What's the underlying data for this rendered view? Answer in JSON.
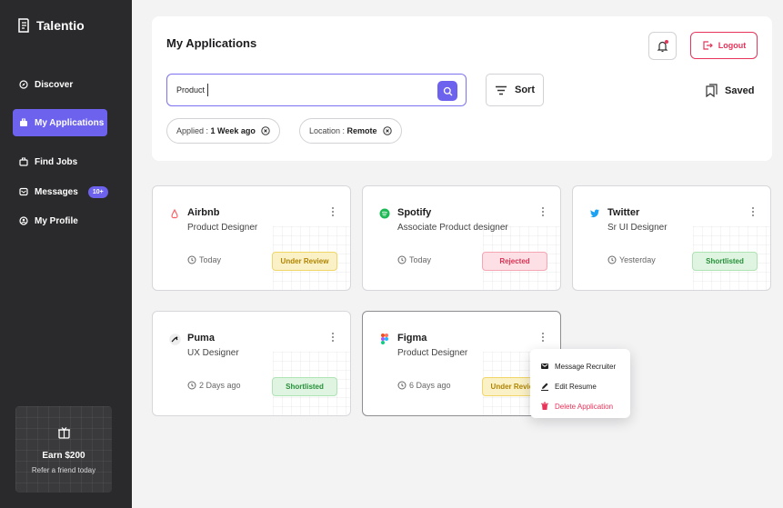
{
  "brand": {
    "name": "Talentio"
  },
  "nav": {
    "discover": "Discover",
    "applications": "My Applications",
    "find_jobs": "Find Jobs",
    "messages": "Messages",
    "messages_badge": "10+",
    "profile": "My Profile"
  },
  "promo": {
    "title": "Earn $200",
    "subtitle": "Refer a friend today"
  },
  "header": {
    "title": "My Applications",
    "logout": "Logout",
    "search_value": "Product",
    "sort": "Sort",
    "saved": "Saved",
    "filters": [
      {
        "label": "Applied : ",
        "value": "1 Week ago"
      },
      {
        "label": "Location : ",
        "value": "Remote"
      }
    ]
  },
  "cards": [
    {
      "company": "Airbnb",
      "role": "Product Designer",
      "time": "Today",
      "status": "Under Review"
    },
    {
      "company": "Spotify",
      "role": "Associate Product designer",
      "time": "Today",
      "status": "Rejected"
    },
    {
      "company": "Twitter",
      "role": "Sr UI Designer",
      "time": "Yesterday",
      "status": "Shortlisted"
    },
    {
      "company": "Puma",
      "role": "UX Designer",
      "time": "2 Days ago",
      "status": "Shortlisted"
    },
    {
      "company": "Figma",
      "role": "Product Designer",
      "time": "6 Days ago",
      "status": "Under Review"
    }
  ],
  "dropdown": {
    "message": "Message Recruiter",
    "edit": "Edit Resume",
    "delete": "Delete Application"
  },
  "colors": {
    "accent": "#6d62ee",
    "danger": "#e8335a",
    "sidebar": "#2a2a2c"
  }
}
